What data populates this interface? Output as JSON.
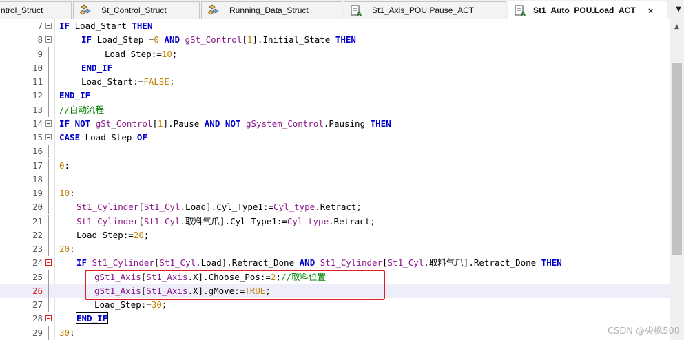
{
  "tabs": [
    {
      "label": "ntrol_Struct",
      "icon": "struct-icon",
      "active": false
    },
    {
      "label": "St_Control_Struct",
      "icon": "struct-icon",
      "active": false
    },
    {
      "label": "Running_Data_Struct",
      "icon": "struct-icon",
      "active": false
    },
    {
      "label": "St1_Axis_POU.Pause_ACT",
      "icon": "action-icon",
      "active": false
    },
    {
      "label": "St1_Auto_POU.Load_ACT",
      "icon": "action-icon",
      "active": true,
      "close": "×"
    }
  ],
  "tab_dropdown": "▼",
  "code": {
    "line_numbers": [
      "7",
      "8",
      "9",
      "10",
      "11",
      "12",
      "13",
      "14",
      "15",
      "16",
      "17",
      "18",
      "19",
      "20",
      "21",
      "22",
      "23",
      "24",
      "25",
      "26",
      "27",
      "28",
      "29"
    ],
    "lines": [
      [
        {
          "t": "IF",
          "k": "k"
        },
        {
          "t": " Load_Start "
        },
        {
          "t": "THEN",
          "k": "k"
        }
      ],
      [
        {
          "t": "IF",
          "k": "k"
        },
        {
          "t": " Load_Step ="
        },
        {
          "t": "0",
          "k": "n"
        },
        {
          "t": " "
        },
        {
          "t": "AND",
          "k": "k"
        },
        {
          "t": " "
        },
        {
          "t": "gSt_Control",
          "k": "v"
        },
        {
          "t": "["
        },
        {
          "t": "1",
          "k": "n"
        },
        {
          "t": "].Initial_State "
        },
        {
          "t": "THEN",
          "k": "k"
        }
      ],
      [
        {
          "t": "Load_Step:="
        },
        {
          "t": "10",
          "k": "n"
        },
        {
          "t": ";"
        }
      ],
      [
        {
          "t": "END_IF",
          "k": "k"
        }
      ],
      [
        {
          "t": "Load_Start:="
        },
        {
          "t": "FALSE",
          "k": "n"
        },
        {
          "t": ";"
        }
      ],
      [
        {
          "t": "END_IF",
          "k": "k"
        }
      ],
      [
        {
          "t": "//自动流程",
          "k": "c"
        }
      ],
      [
        {
          "t": "IF",
          "k": "k"
        },
        {
          "t": " "
        },
        {
          "t": "NOT",
          "k": "k"
        },
        {
          "t": " "
        },
        {
          "t": "gSt_Control",
          "k": "v"
        },
        {
          "t": "["
        },
        {
          "t": "1",
          "k": "n"
        },
        {
          "t": "].Pause "
        },
        {
          "t": "AND",
          "k": "k"
        },
        {
          "t": " "
        },
        {
          "t": "NOT",
          "k": "k"
        },
        {
          "t": " "
        },
        {
          "t": "gSystem_Control",
          "k": "v"
        },
        {
          "t": ".Pausing "
        },
        {
          "t": "THEN",
          "k": "k"
        }
      ],
      [
        {
          "t": "CASE",
          "k": "k"
        },
        {
          "t": " Load_Step "
        },
        {
          "t": "OF",
          "k": "k"
        }
      ],
      [],
      [
        {
          "t": "0",
          "k": "n"
        },
        {
          "t": ":"
        }
      ],
      [],
      [
        {
          "t": "10",
          "k": "n"
        },
        {
          "t": ":"
        }
      ],
      [
        {
          "t": "St1_Cylinder",
          "k": "v"
        },
        {
          "t": "["
        },
        {
          "t": "St1_Cyl",
          "k": "v"
        },
        {
          "t": ".Load].Cyl_Type1:="
        },
        {
          "t": "Cyl_type",
          "k": "v"
        },
        {
          "t": ".Retract;"
        }
      ],
      [
        {
          "t": "St1_Cylinder",
          "k": "v"
        },
        {
          "t": "["
        },
        {
          "t": "St1_Cyl",
          "k": "v"
        },
        {
          "t": ".取料气爪].Cyl_Type1:="
        },
        {
          "t": "Cyl_type",
          "k": "v"
        },
        {
          "t": ".Retract;"
        }
      ],
      [
        {
          "t": "Load_Step:="
        },
        {
          "t": "20",
          "k": "n"
        },
        {
          "t": ";"
        }
      ],
      [
        {
          "t": "20",
          "k": "n"
        },
        {
          "t": ":"
        }
      ],
      [
        {
          "t": "IF",
          "k": "k",
          "box": true
        },
        {
          "t": " "
        },
        {
          "t": "St1_Cylinder",
          "k": "v"
        },
        {
          "t": "["
        },
        {
          "t": "St1_Cyl",
          "k": "v"
        },
        {
          "t": ".Load].Retract_Done "
        },
        {
          "t": "AND",
          "k": "k"
        },
        {
          "t": " "
        },
        {
          "t": "St1_Cylinder",
          "k": "v"
        },
        {
          "t": "["
        },
        {
          "t": "St1_Cyl",
          "k": "v"
        },
        {
          "t": ".取料气爪].Retract_Done "
        },
        {
          "t": "THEN",
          "k": "k"
        }
      ],
      [
        {
          "t": "gSt1_Axis",
          "k": "v"
        },
        {
          "t": "["
        },
        {
          "t": "St1_Axis",
          "k": "v"
        },
        {
          "t": ".X].Choose_Pos:="
        },
        {
          "t": "2",
          "k": "n"
        },
        {
          "t": ";"
        },
        {
          "t": "//取料位置",
          "k": "c"
        }
      ],
      [
        {
          "t": "gSt1_Axis",
          "k": "v"
        },
        {
          "t": "["
        },
        {
          "t": "St1_Axis",
          "k": "v"
        },
        {
          "t": ".X].gMove:="
        },
        {
          "t": "TRUE",
          "k": "n"
        },
        {
          "t": ";"
        }
      ],
      [
        {
          "t": "Load_Step:="
        },
        {
          "t": "30",
          "k": "n"
        },
        {
          "t": ";"
        }
      ],
      [
        {
          "t": "END_IF",
          "k": "k",
          "box": true
        }
      ],
      [
        {
          "t": "30",
          "k": "n"
        },
        {
          "t": ":"
        }
      ]
    ]
  },
  "watermark": "CSDN @尖枫508",
  "scrollbar_up": "▲"
}
